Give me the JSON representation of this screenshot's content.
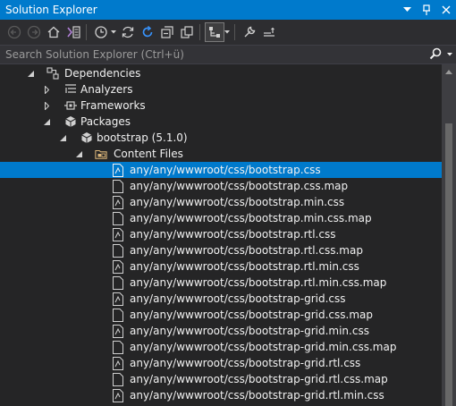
{
  "window": {
    "title": "Solution Explorer"
  },
  "search": {
    "placeholder": "Search Solution Explorer (Ctrl+ü)"
  },
  "tree": {
    "dependencies": "Dependencies",
    "analyzers": "Analyzers",
    "frameworks": "Frameworks",
    "packages": "Packages",
    "bootstrap": "bootstrap (5.1.0)",
    "content_files": "Content Files",
    "files": [
      "any/any/wwwroot/css/bootstrap.css",
      "any/any/wwwroot/css/bootstrap.css.map",
      "any/any/wwwroot/css/bootstrap.min.css",
      "any/any/wwwroot/css/bootstrap.min.css.map",
      "any/any/wwwroot/css/bootstrap.rtl.css",
      "any/any/wwwroot/css/bootstrap.rtl.css.map",
      "any/any/wwwroot/css/bootstrap.rtl.min.css",
      "any/any/wwwroot/css/bootstrap.rtl.min.css.map",
      "any/any/wwwroot/css/bootstrap-grid.css",
      "any/any/wwwroot/css/bootstrap-grid.css.map",
      "any/any/wwwroot/css/bootstrap-grid.min.css",
      "any/any/wwwroot/css/bootstrap-grid.min.css.map",
      "any/any/wwwroot/css/bootstrap-grid.rtl.css",
      "any/any/wwwroot/css/bootstrap-grid.rtl.css.map",
      "any/any/wwwroot/css/bootstrap-grid.rtl.min.css"
    ]
  },
  "colors": {
    "accent": "#007acc",
    "background": "#252526",
    "toolbar": "#2d2d30"
  }
}
